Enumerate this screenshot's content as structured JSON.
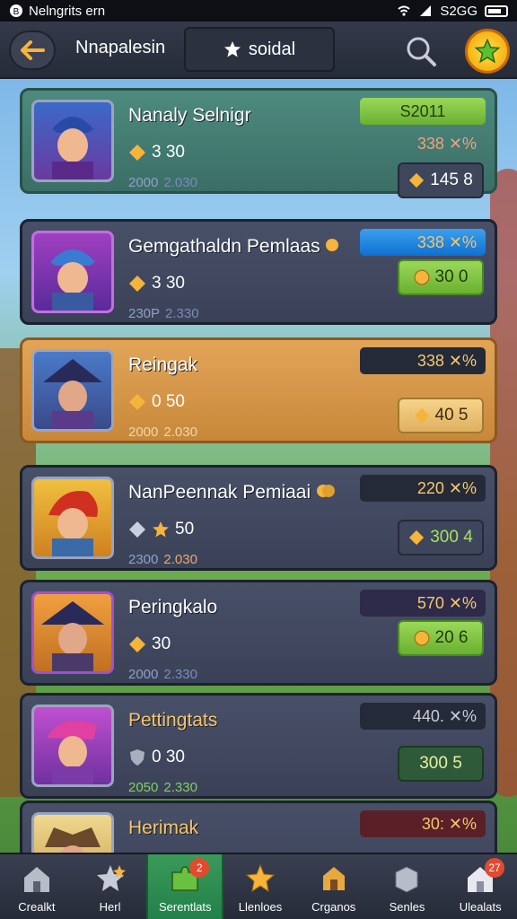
{
  "status_bar": {
    "title": "Nelngrits ern",
    "time": "S2GG"
  },
  "header": {
    "title": "Nnapalesin",
    "tab_label": "soidal"
  },
  "rows": [
    {
      "name": "Nanaly Selnigr",
      "stat": "3  30",
      "sub_a": "2000",
      "sub_b": "2.030",
      "chip": "S2011",
      "chip2": "338 ✕%",
      "action": "145  8"
    },
    {
      "name": "Gemgathaldn Pemlaas",
      "stat": "3  30",
      "sub_a": "230P",
      "sub_b": "2.330",
      "chip": "338 ✕%",
      "action": "30  0"
    },
    {
      "name": "Reingak",
      "stat": "0  50",
      "sub_a": "2000",
      "sub_b": "2.030",
      "chip": "338 ✕%",
      "action": "40  5"
    },
    {
      "name": "NanPeennak Pemiaai",
      "stat": "50",
      "sub_a": "2300",
      "sub_b": "2.030",
      "chip": "220 ✕%",
      "action": "300 4"
    },
    {
      "name": "Peringkalo",
      "stat": "30",
      "sub_a": "2000",
      "sub_b": "2.330",
      "chip": "570 ✕%",
      "action": "20  6"
    },
    {
      "name": "Pettingtats",
      "stat": "0  30",
      "sub_a": "2050",
      "sub_b": "2.330",
      "chip": "440. ✕%",
      "action": "300 5"
    },
    {
      "name": "Herimak",
      "chip": "30: ✕%"
    }
  ],
  "nav": [
    {
      "label": "Crealkt",
      "badge": ""
    },
    {
      "label": "Herl",
      "badge": ""
    },
    {
      "label": "Serentlats",
      "badge": "2"
    },
    {
      "label": "Llenloes",
      "badge": ""
    },
    {
      "label": "Crganos",
      "badge": ""
    },
    {
      "label": "Senles",
      "badge": ""
    },
    {
      "label": "Ulealats",
      "badge": "27"
    }
  ],
  "colors": {
    "accent_green": "#6ab030",
    "accent_gold": "#f6c56a",
    "panel_dark": "#3a4157"
  }
}
